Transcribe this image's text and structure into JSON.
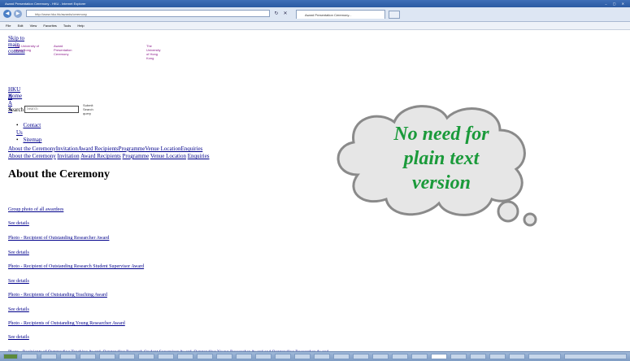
{
  "browser": {
    "window_title": "Award Presentation Ceremony - HKU - Internet Explorer",
    "url": "http://www.hku.hk/awards/ceremony",
    "tab_title": "Award Presentation Ceremony...",
    "menu": [
      "File",
      "Edit",
      "View",
      "Favorites",
      "Tools",
      "Help"
    ]
  },
  "page": {
    "skip_link": "Skip to main content",
    "header_left": "The University of Hong Kong",
    "header_mid": "Award Presentation Ceremony",
    "header_right": "The University of Hong Kong",
    "hku_home": "HKU Home",
    "font_sizes": "A A A",
    "search_label": "Search",
    "search_placeholder": "Search",
    "submit_label": "Submit Search query",
    "bullets": [
      "Contact Us",
      "Sitemap"
    ],
    "nav_row1": [
      "About the Ceremony",
      "Invitation",
      "Award Recipients",
      "Programme",
      "Venue Location",
      "Enquiries"
    ],
    "nav_row2": [
      "About the Ceremony",
      "Invitation",
      "Award Recipients",
      "Programme",
      "Venue Location",
      "Enquiries"
    ],
    "title": "About the Ceremony",
    "items": [
      "Group photo of all awardees",
      "See details",
      "Photo - Recipient of Outstanding Researcher Award",
      "See details",
      "Photo - Recipient of Outstanding Research Student Supervisor Award",
      "See details",
      "Photo - Recipients of Outstanding Teaching Award",
      "See details",
      "Photo - Recipients of Outstanding Young Researcher Award",
      "See details",
      "Photo - Recipients of Outstanding Teaching Award, Outstanding Research Student Supervisor Award, Outstanding Young Researcher Award and Outstanding Researcher Award"
    ]
  },
  "callout": {
    "lines": [
      "No need for",
      "plain text",
      "version"
    ],
    "color": "#1a9a3a"
  }
}
